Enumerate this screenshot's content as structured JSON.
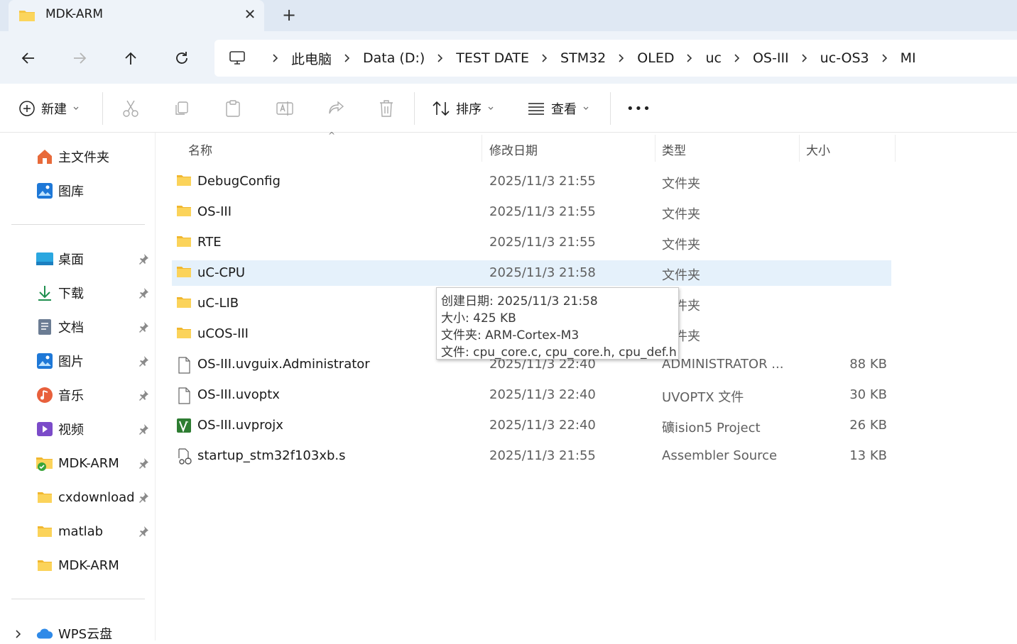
{
  "tab": {
    "title": "MDK-ARM",
    "close": "✕",
    "new_tab": "+"
  },
  "breadcrumbs": [
    "此电脑",
    "Data (D:)",
    "TEST DATE",
    "STM32",
    "OLED",
    "uc",
    "OS-III",
    "uc-OS3",
    "MI"
  ],
  "toolbar": {
    "new_label": "新建",
    "sort_label": "排序",
    "view_label": "查看",
    "more_label": "•••"
  },
  "sidebar": {
    "top": [
      {
        "label": "主文件夹",
        "icon": "home-icon"
      },
      {
        "label": "图库",
        "icon": "gallery-icon"
      }
    ],
    "pinned": [
      {
        "label": "桌面",
        "icon": "desktop-icon",
        "pinned": true
      },
      {
        "label": "下载",
        "icon": "download-icon",
        "pinned": true
      },
      {
        "label": "文档",
        "icon": "document-icon",
        "pinned": true
      },
      {
        "label": "图片",
        "icon": "pictures-icon",
        "pinned": true
      },
      {
        "label": "音乐",
        "icon": "music-icon",
        "pinned": true
      },
      {
        "label": "视频",
        "icon": "video-icon",
        "pinned": true
      },
      {
        "label": "MDK-ARM",
        "icon": "folder-synced-icon",
        "pinned": true
      },
      {
        "label": "cxdownload",
        "icon": "folder-icon",
        "pinned": true
      },
      {
        "label": "matlab",
        "icon": "folder-icon",
        "pinned": true
      },
      {
        "label": "MDK-ARM",
        "icon": "folder-icon",
        "pinned": false
      }
    ],
    "bottom": [
      {
        "label": "WPS云盘",
        "icon": "cloud-icon"
      }
    ]
  },
  "columns": {
    "name": "名称",
    "date": "修改日期",
    "type": "类型",
    "size": "大小"
  },
  "files": [
    {
      "name": "DebugConfig",
      "date": "2025/11/3 21:55",
      "type": "文件夹",
      "size": "",
      "icon": "folder-icon"
    },
    {
      "name": "OS-III",
      "date": "2025/11/3 21:55",
      "type": "文件夹",
      "size": "",
      "icon": "folder-icon"
    },
    {
      "name": "RTE",
      "date": "2025/11/3 21:55",
      "type": "文件夹",
      "size": "",
      "icon": "folder-icon"
    },
    {
      "name": "uC-CPU",
      "date": "2025/11/3 21:58",
      "type": "文件夹",
      "size": "",
      "icon": "folder-icon",
      "selected": true
    },
    {
      "name": "uC-LIB",
      "date": "",
      "type": "件夹",
      "size": "",
      "icon": "folder-icon"
    },
    {
      "name": "uCOS-III",
      "date": "",
      "type": "件夹",
      "size": "",
      "icon": "folder-icon"
    },
    {
      "name": "OS-III.uvguix.Administrator",
      "date": "2025/11/3 22:40",
      "type": "ADMINISTRATOR ...",
      "size": "88 KB",
      "icon": "file-icon"
    },
    {
      "name": "OS-III.uvoptx",
      "date": "2025/11/3 22:40",
      "type": "UVOPTX 文件",
      "size": "30 KB",
      "icon": "file-icon"
    },
    {
      "name": "OS-III.uvprojx",
      "date": "2025/11/3 22:40",
      "type": "礦ision5 Project",
      "size": "26 KB",
      "icon": "uvision-icon"
    },
    {
      "name": "startup_stm32f103xb.s",
      "date": "2025/11/3 21:55",
      "type": "Assembler Source",
      "size": "13 KB",
      "icon": "assembler-file-icon"
    }
  ],
  "tooltip": {
    "created": "创建日期: 2025/11/3 21:58",
    "size": "大小: 425 KB",
    "folders": "文件夹: ARM-Cortex-M3",
    "files": "文件: cpu_core.c, cpu_core.h, cpu_def.h"
  },
  "colors": {
    "folder": "#f5c542",
    "selection": "#e5f1fb",
    "accent": "#0067c0",
    "titlebar": "#dfe8f3"
  }
}
